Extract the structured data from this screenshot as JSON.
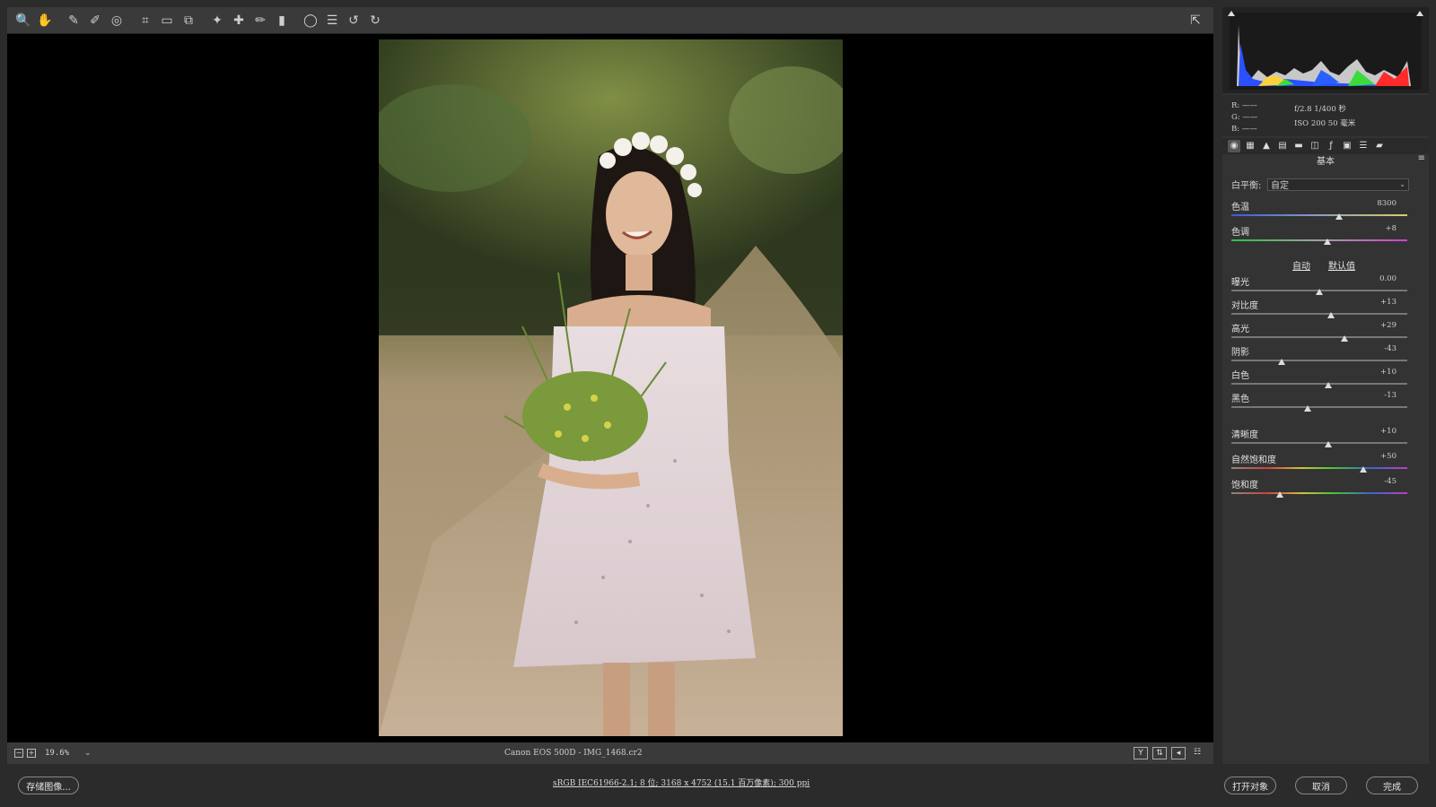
{
  "toolbar": {
    "tools": [
      {
        "name": "zoom-tool-icon",
        "glyph": "🔍"
      },
      {
        "name": "hand-tool-icon",
        "glyph": "✋"
      },
      {
        "name": "white-balance-tool-icon",
        "glyph": "✎"
      },
      {
        "name": "color-sampler-tool-icon",
        "glyph": "✐"
      },
      {
        "name": "targeted-adjustment-tool-icon",
        "glyph": "◎"
      },
      {
        "name": "crop-tool-icon",
        "glyph": "⌗"
      },
      {
        "name": "straighten-tool-icon",
        "glyph": "▭"
      },
      {
        "name": "transform-tool-icon",
        "glyph": "⧉"
      },
      {
        "name": "spot-removal-tool-icon",
        "glyph": "✦"
      },
      {
        "name": "red-eye-removal-icon",
        "glyph": "✚"
      },
      {
        "name": "adjustment-brush-icon",
        "glyph": "✏"
      },
      {
        "name": "graduated-filter-icon",
        "glyph": "▮"
      },
      {
        "name": "radial-filter-icon",
        "glyph": "◯"
      },
      {
        "name": "preferences-icon",
        "glyph": "☰"
      },
      {
        "name": "rotate-left-icon",
        "glyph": "↺"
      },
      {
        "name": "rotate-right-icon",
        "glyph": "↻"
      }
    ],
    "fullscreen_glyph": "⇱"
  },
  "histogram": {
    "rgb": {
      "r": "R: ——",
      "g": "G: ——",
      "b": "B: ——"
    },
    "exif_line1": "f/2.8  1/400 秒",
    "exif_line2": "ISO 200  50 毫米"
  },
  "panel": {
    "section_title": "基本",
    "white_balance_label": "白平衡:",
    "white_balance_value": "自定",
    "auto_label": "自动",
    "default_label": "默认值",
    "sliders": [
      {
        "key": "temp",
        "label": "色温",
        "value": "8300",
        "pos": 0.61
      },
      {
        "key": "tint",
        "label": "色调",
        "value": "+8",
        "pos": 0.545
      },
      {
        "key": "exposure",
        "label": "曝光",
        "value": "0.00",
        "pos": 0.5
      },
      {
        "key": "contrast",
        "label": "对比度",
        "value": "+13",
        "pos": 0.565
      },
      {
        "key": "highlights",
        "label": "高光",
        "value": "+29",
        "pos": 0.645
      },
      {
        "key": "shadows",
        "label": "阴影",
        "value": "-43",
        "pos": 0.285
      },
      {
        "key": "whites",
        "label": "白色",
        "value": "+10",
        "pos": 0.55
      },
      {
        "key": "blacks",
        "label": "黑色",
        "value": "-13",
        "pos": 0.435
      },
      {
        "key": "clarity",
        "label": "清晰度",
        "value": "+10",
        "pos": 0.55
      },
      {
        "key": "vibrance",
        "label": "自然饱和度",
        "value": "+50",
        "pos": 0.75
      },
      {
        "key": "saturation",
        "label": "饱和度",
        "value": "-45",
        "pos": 0.275
      }
    ]
  },
  "statusbar": {
    "zoom": "19.6%",
    "file": "Canon EOS 500D -  IMG_1468.cr2"
  },
  "footer": {
    "save_label": "存储图像...",
    "info": "sRGB IEC61966-2.1; 8 位; 3168 x 4752 (15.1 百万像素); 300 ppi",
    "open_label": "打开对象",
    "cancel_label": "取消",
    "done_label": "完成"
  }
}
